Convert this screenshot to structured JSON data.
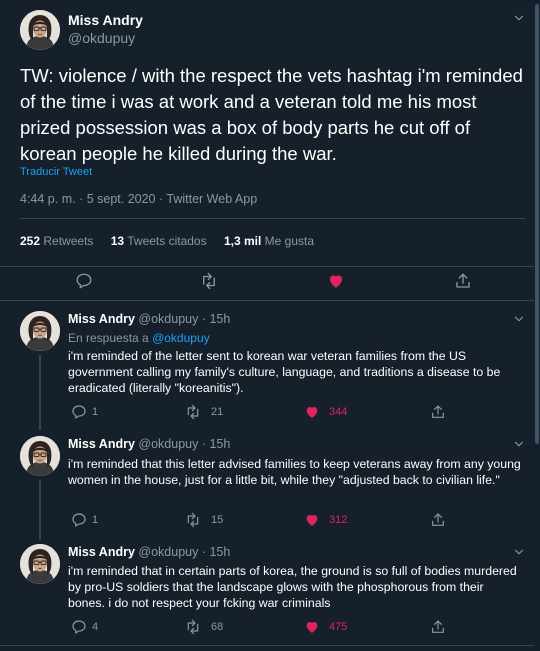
{
  "colors": {
    "background": "#15202b",
    "accent": "#1da1f2",
    "like": "#e0245e",
    "muted": "#8899a6"
  },
  "main_tweet": {
    "author_name": "Miss Andry",
    "author_handle": "@okdupuy",
    "text": "TW: violence / with the respect the vets hashtag i'm reminded of the time i was at work and a veteran told me his most prized possession was a box of body parts he cut off of korean people he killed during the war.",
    "translate_label": "Traducir Tweet",
    "timestamp": "4:44 p. m. · 5 sept. 2020 · Twitter Web App",
    "stats": {
      "retweets_count": "252",
      "retweets_label": "Retweets",
      "quotes_count": "13",
      "quotes_label": "Tweets citados",
      "likes_count": "1,3 mil",
      "likes_label": "Me gusta"
    },
    "actions": [
      "reply-icon",
      "retweet-icon",
      "like-icon-filled",
      "share-icon"
    ]
  },
  "replies": [
    {
      "author_name": "Miss Andry",
      "author_handle": "@okdupuy · 15h",
      "replying_prefix": "En respuesta a",
      "replying_to": "@okdupuy",
      "text": "i'm reminded of the letter sent to korean war veteran families from the US government calling my family's culture, language, and traditions a disease to be eradicated (literally \"koreanitis\").",
      "reply_count": "1",
      "retweet_count": "21",
      "like_count": "344"
    },
    {
      "author_name": "Miss Andry",
      "author_handle": "@okdupuy · 15h",
      "text": "i'm reminded that this letter advised families to keep veterans away from any young women in the house, just for a little bit, while they \"adjusted back to civilian life.\"",
      "reply_count": "1",
      "retweet_count": "15",
      "like_count": "312"
    },
    {
      "author_name": "Miss Andry",
      "author_handle": "@okdupuy · 15h",
      "text": "i'm reminded that in certain parts of korea, the ground is so full of bodies murdered by pro-US soldiers that the landscape glows with the phosphorous from their bones. i do not respect your fcking war criminals",
      "reply_count": "4",
      "retweet_count": "68",
      "like_count": "475"
    }
  ]
}
